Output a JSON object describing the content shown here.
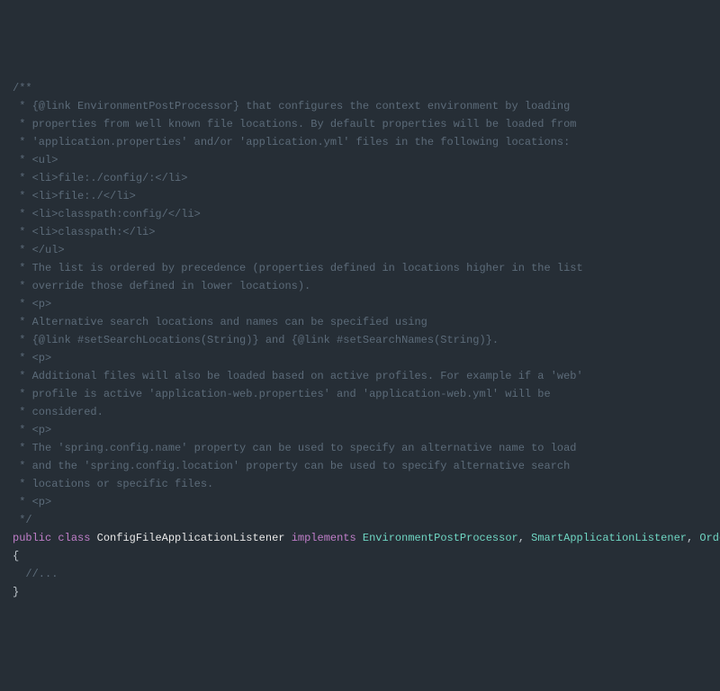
{
  "lines": [
    {
      "type": "comment",
      "text": "/**"
    },
    {
      "type": "comment",
      "text": " * {@link EnvironmentPostProcessor} that configures the context environment by loading"
    },
    {
      "type": "comment",
      "text": " * properties from well known file locations. By default properties will be loaded from"
    },
    {
      "type": "comment",
      "text": " * 'application.properties' and/or 'application.yml' files in the following locations:"
    },
    {
      "type": "comment",
      "text": " * <ul>"
    },
    {
      "type": "comment",
      "text": " * <li>file:./config/:</li>"
    },
    {
      "type": "comment",
      "text": " * <li>file:./</li>"
    },
    {
      "type": "comment",
      "text": " * <li>classpath:config/</li>"
    },
    {
      "type": "comment",
      "text": " * <li>classpath:</li>"
    },
    {
      "type": "comment",
      "text": " * </ul>"
    },
    {
      "type": "comment",
      "text": " * The list is ordered by precedence (properties defined in locations higher in the list"
    },
    {
      "type": "comment",
      "text": " * override those defined in lower locations)."
    },
    {
      "type": "comment",
      "text": " * <p>"
    },
    {
      "type": "comment",
      "text": " * Alternative search locations and names can be specified using"
    },
    {
      "type": "comment",
      "text": " * {@link #setSearchLocations(String)} and {@link #setSearchNames(String)}."
    },
    {
      "type": "comment",
      "text": " * <p>"
    },
    {
      "type": "comment",
      "text": " * Additional files will also be loaded based on active profiles. For example if a 'web'"
    },
    {
      "type": "comment",
      "text": " * profile is active 'application-web.properties' and 'application-web.yml' will be"
    },
    {
      "type": "comment",
      "text": " * considered."
    },
    {
      "type": "comment",
      "text": " * <p>"
    },
    {
      "type": "comment",
      "text": " * The 'spring.config.name' property can be used to specify an alternative name to load"
    },
    {
      "type": "comment",
      "text": " * and the 'spring.config.location' property can be used to specify alternative search"
    },
    {
      "type": "comment",
      "text": " * locations or specific files."
    },
    {
      "type": "comment",
      "text": " * <p>"
    },
    {
      "type": "comment",
      "text": " */"
    }
  ],
  "decl": {
    "kw_public": "public",
    "kw_class": "class",
    "class_name": "ConfigFileApplicationListener",
    "kw_implements": "implements",
    "iface1": "EnvironmentPostProcessor",
    "iface2": "SmartApplicationListener",
    "iface3": "Ordered",
    "comma": ",",
    "space": " "
  },
  "body": {
    "open": "{",
    "body_comment": "  //...",
    "close": "}"
  }
}
